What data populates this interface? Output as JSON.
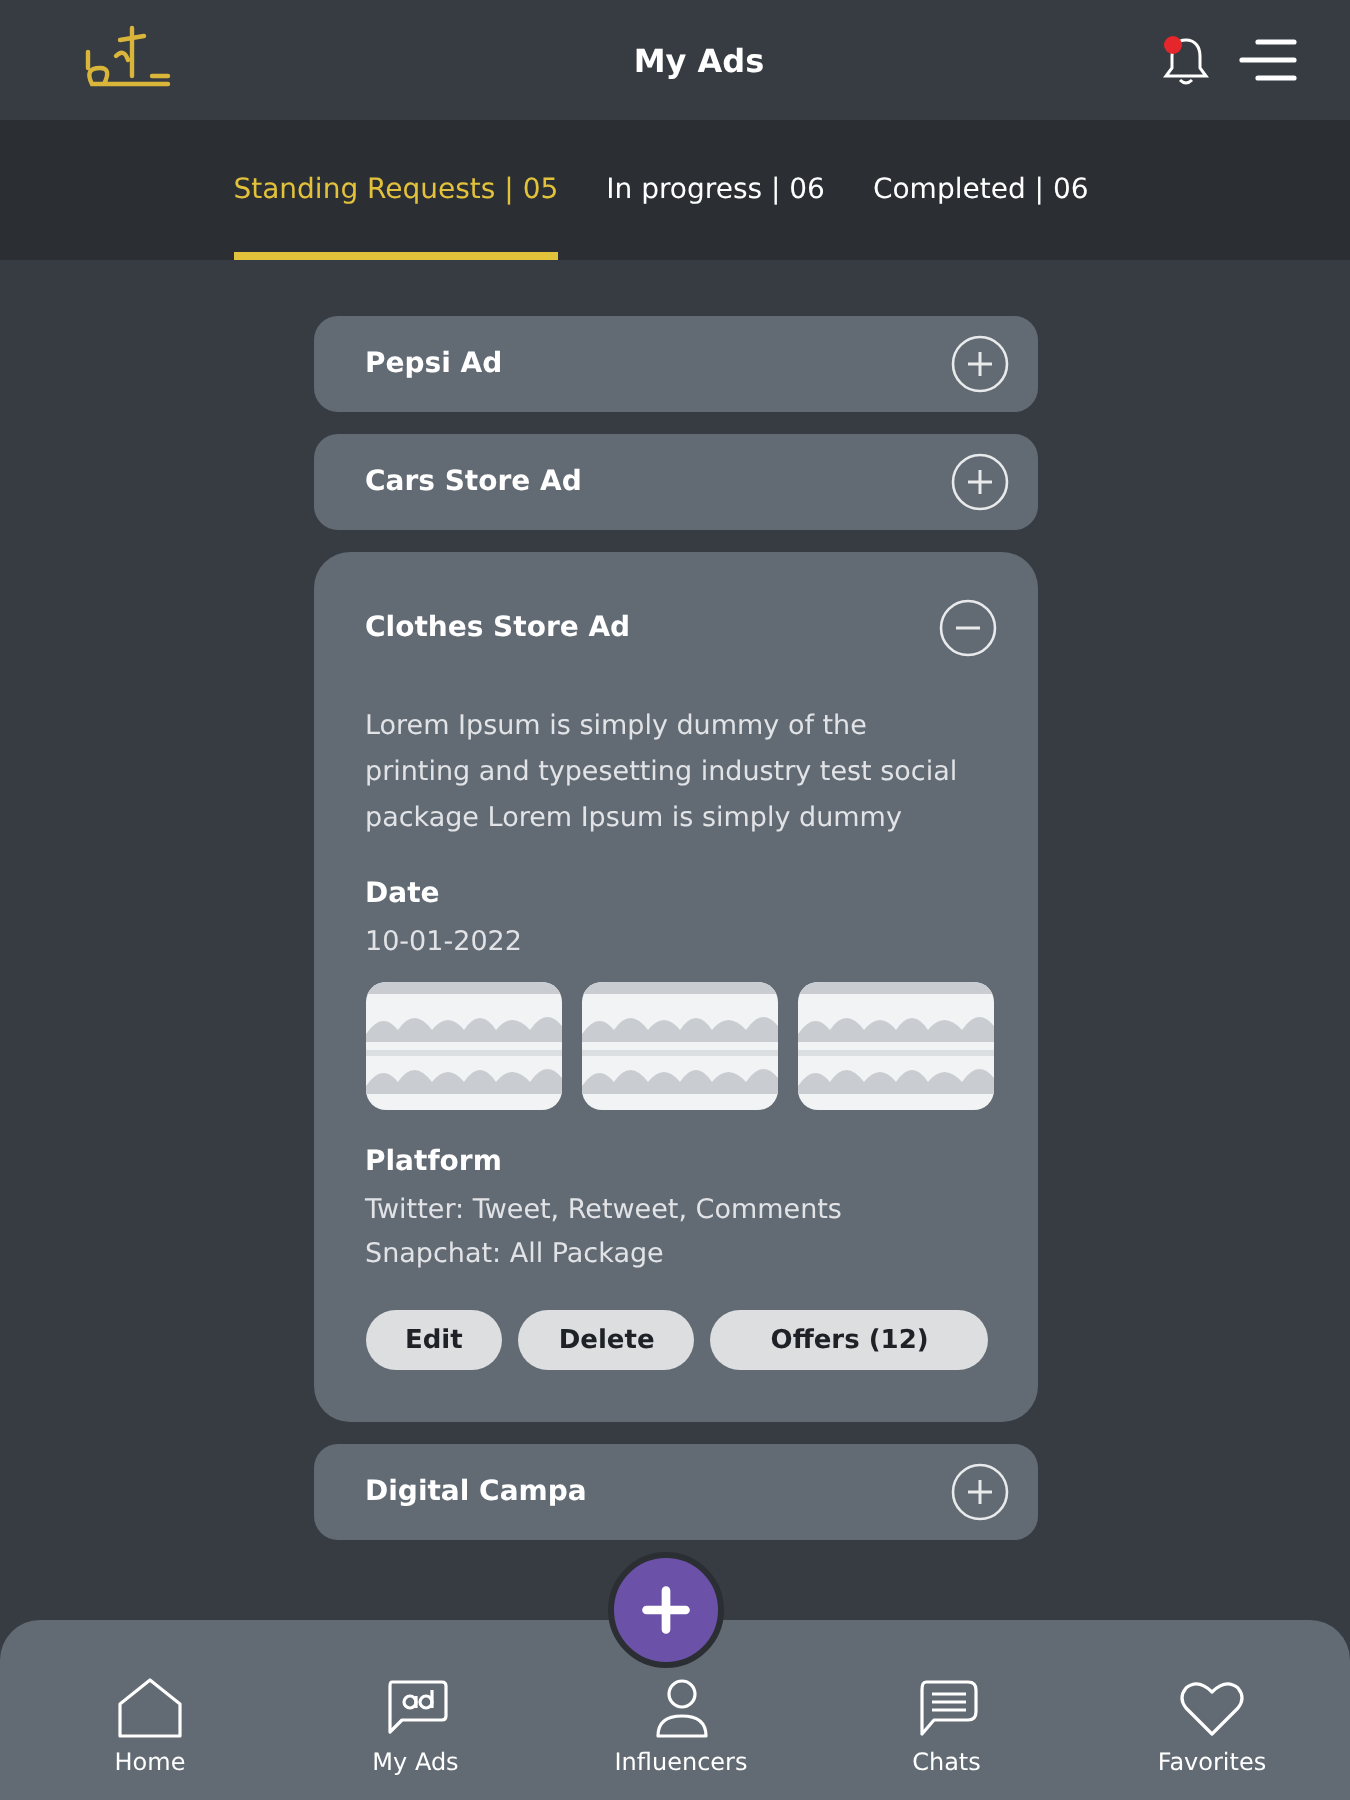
{
  "header": {
    "title": "My Ads",
    "notification": {
      "unread": true
    }
  },
  "tabs": [
    {
      "label": "Standing Requests | 05",
      "selected": true
    },
    {
      "label": "In progress | 06",
      "selected": false
    },
    {
      "label": "Completed | 06",
      "selected": false
    }
  ],
  "ads": [
    {
      "title": "Pepsi Ad",
      "expanded": false
    },
    {
      "title": "Cars Store Ad",
      "expanded": false
    },
    {
      "title": "Clothes Store Ad",
      "expanded": true,
      "description": "Lorem Ipsum is simply dummy of the printing and typesetting industry test social package Lorem Ipsum is simply dummy",
      "date_label": "Date",
      "date": "10-01-2022",
      "images": [
        {
          "kind": "picture"
        },
        {
          "kind": "picture"
        },
        {
          "kind": "picture"
        }
      ],
      "platform_label": "Platform",
      "platforms": [
        "Twitter: Tweet, Retweet, Comments",
        "Snapchat: All Package"
      ],
      "actions": [
        "Edit",
        "Delete",
        "Offers (12)"
      ]
    },
    {
      "title": "Digital Campa",
      "expanded": false
    }
  ],
  "bottom_nav": [
    {
      "label": "Home",
      "kind": "home"
    },
    {
      "label": "My Ads",
      "kind": "ads"
    },
    {
      "label": "Influencers",
      "kind": "person"
    },
    {
      "label": "Chats",
      "kind": "chat"
    },
    {
      "label": "Favorites",
      "kind": "heart"
    }
  ]
}
